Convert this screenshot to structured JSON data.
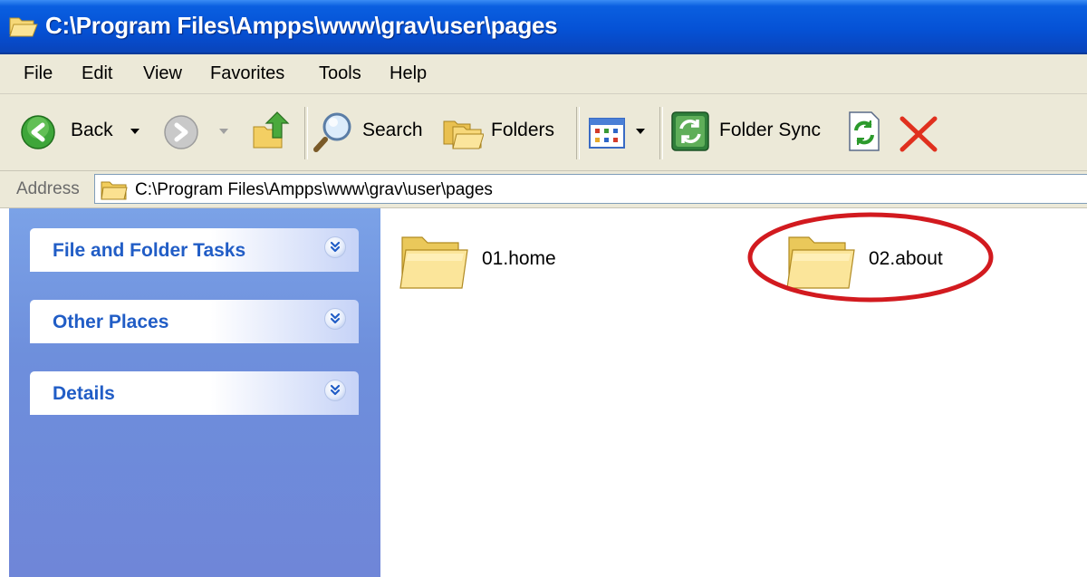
{
  "window": {
    "title": "C:\\Program Files\\Ampps\\www\\grav\\user\\pages"
  },
  "menu": [
    "File",
    "Edit",
    "View",
    "Favorites",
    "Tools",
    "Help"
  ],
  "toolbar": {
    "back_label": "Back",
    "search_label": "Search",
    "folders_label": "Folders",
    "folder_sync_label": "Folder Sync"
  },
  "address": {
    "label": "Address",
    "value": "C:\\Program Files\\Ampps\\www\\grav\\user\\pages"
  },
  "tasks": {
    "panels": [
      "File and Folder Tasks",
      "Other Places",
      "Details"
    ]
  },
  "content": {
    "folders": [
      "01.home",
      "02.about"
    ],
    "highlighted_folder": "02.about"
  },
  "colors": {
    "titlebar": "#0552d6",
    "chrome": "#ece9d8",
    "task_pane": "#6e8fdc",
    "task_title": "#215dc6",
    "highlight_ring": "#d21a1f"
  },
  "icons": {
    "title": "folder-open-icon",
    "back": "back-arrow-icon",
    "forward": "forward-arrow-icon",
    "up": "up-folder-icon",
    "search": "magnifier-icon",
    "folders": "folders-icon",
    "views": "views-icon",
    "folder_sync": "folder-sync-icon",
    "refresh": "refresh-icon",
    "delete": "delete-x-icon",
    "expand": "chevron-double-down-icon"
  }
}
